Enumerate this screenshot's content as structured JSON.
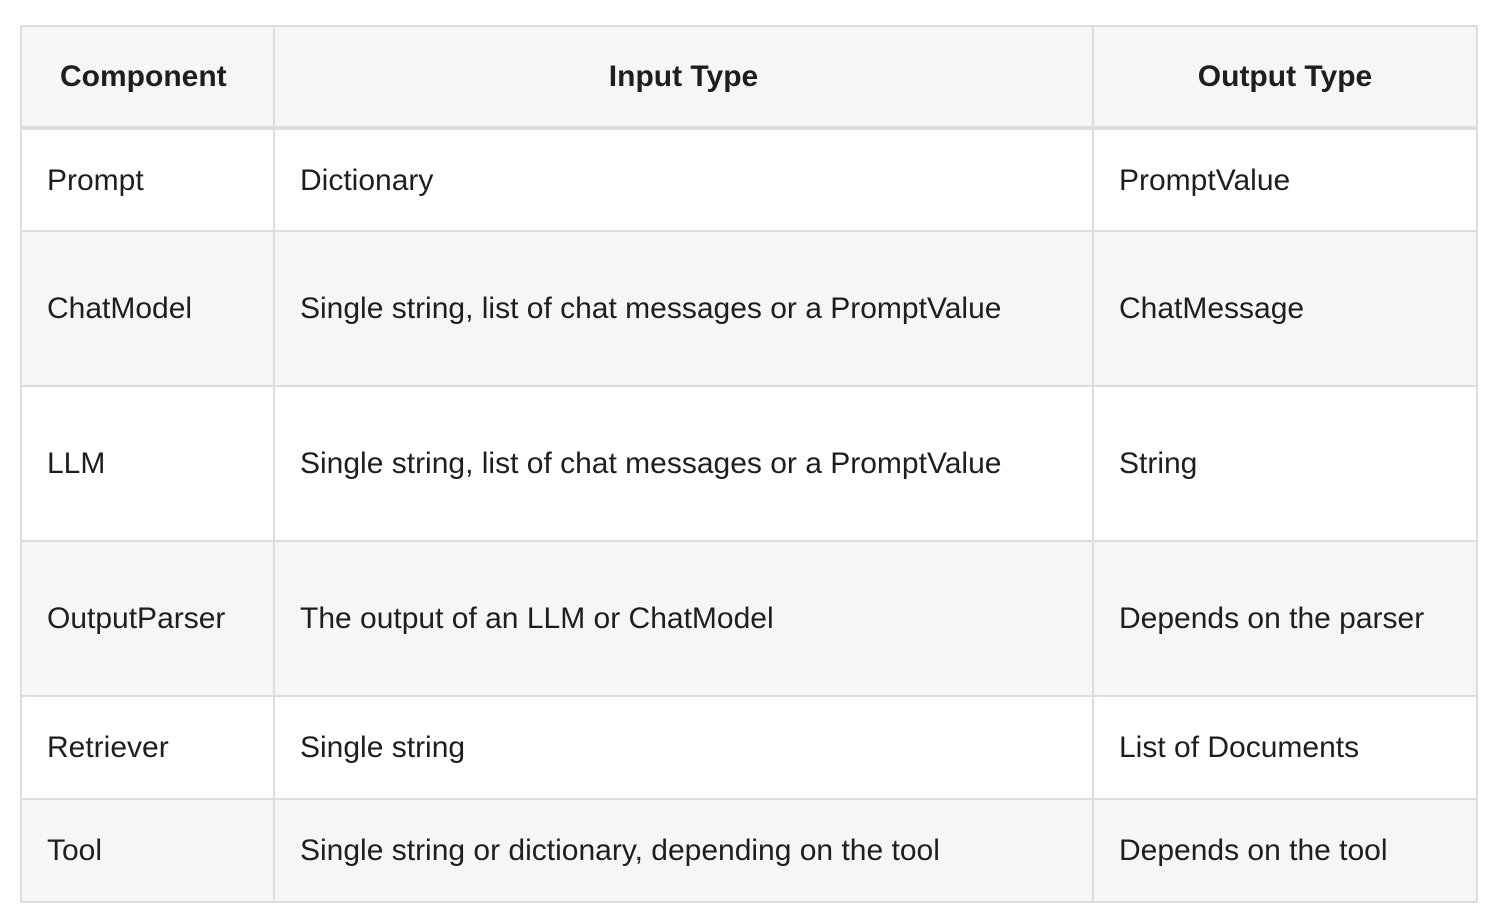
{
  "table": {
    "headers": [
      "Component",
      "Input Type",
      "Output Type"
    ],
    "rows": [
      [
        "Prompt",
        "Dictionary",
        "PromptValue"
      ],
      [
        "ChatModel",
        "Single string, list of chat messages or a PromptValue",
        "ChatMessage"
      ],
      [
        "LLM",
        "Single string, list of chat messages or a PromptValue",
        "String"
      ],
      [
        "OutputParser",
        "The output of an LLM or ChatModel",
        "Depends on the parser"
      ],
      [
        "Retriever",
        "Single string",
        "List of Documents"
      ],
      [
        "Tool",
        "Single string or dictionary, depending on the tool",
        "Depends on the tool"
      ]
    ]
  }
}
